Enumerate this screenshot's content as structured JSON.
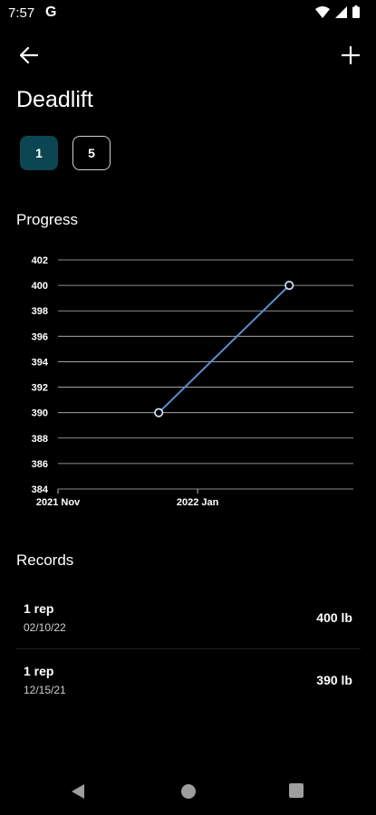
{
  "status_bar": {
    "time": "7:57",
    "g_label": "G"
  },
  "app_bar": {
    "back_icon": "arrow-left-icon",
    "add_icon": "plus-icon"
  },
  "title": "Deadlift",
  "rep_filters": [
    {
      "label": "1",
      "selected": true
    },
    {
      "label": "5",
      "selected": false
    }
  ],
  "progress_label": "Progress",
  "records_label": "Records",
  "colors": {
    "selected_chip": "#0d4653",
    "line": "#5b8fcf",
    "grid": "#bdbdbd"
  },
  "chart_data": {
    "type": "line",
    "x": [
      "2021-12-15",
      "2022-02-10"
    ],
    "x_tick_labels": [
      "2021 Nov",
      "2022 Jan"
    ],
    "x_ticks": [
      "2021-11-01",
      "2022-01-01"
    ],
    "xlim": [
      "2021-11-01",
      "2022-03-10"
    ],
    "series": [
      {
        "values": [
          390,
          400
        ]
      }
    ],
    "ylim": [
      384,
      402
    ],
    "y_ticks": [
      384,
      386,
      388,
      390,
      392,
      394,
      396,
      398,
      400,
      402
    ],
    "grid": true
  },
  "records": [
    {
      "reps": "1 rep",
      "date": "02/10/22",
      "weight": "400 lb"
    },
    {
      "reps": "1 rep",
      "date": "12/15/21",
      "weight": "390 lb"
    }
  ]
}
